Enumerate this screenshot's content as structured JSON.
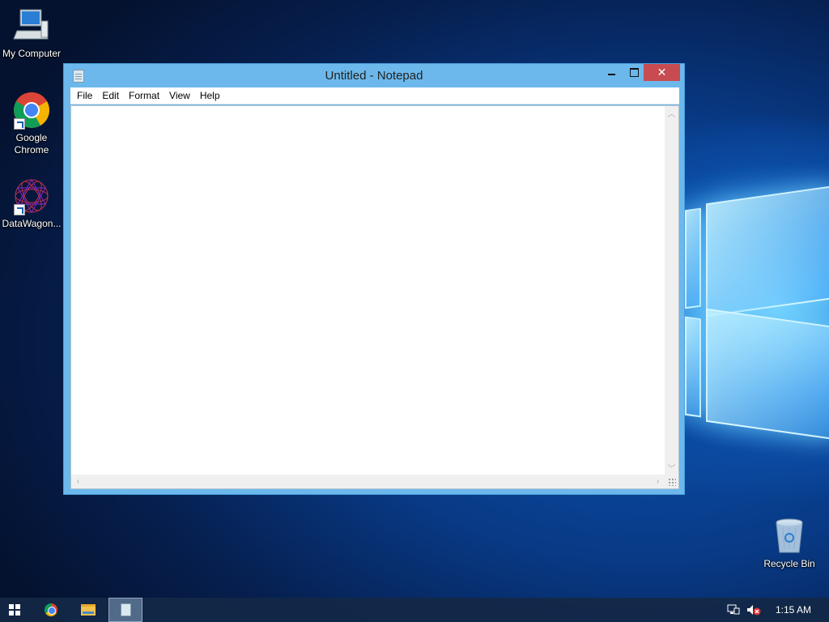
{
  "desktop": {
    "icons": [
      {
        "label": "My Computer",
        "icon": "computer-icon"
      },
      {
        "label": "Google Chrome",
        "icon": "chrome-icon"
      },
      {
        "label": "DataWagon...",
        "icon": "datawagon-icon"
      },
      {
        "label": "Recycle Bin",
        "icon": "recycle-bin-icon"
      }
    ]
  },
  "window": {
    "title": "Untitled - Notepad",
    "close_glyph": "✕",
    "menu": [
      "File",
      "Edit",
      "Format",
      "View",
      "Help"
    ],
    "content": "",
    "scroll_up_glyph": "︿",
    "scroll_down_glyph": "﹀",
    "scroll_left_glyph": "‹",
    "scroll_right_glyph": "›"
  },
  "taskbar": {
    "items": [
      {
        "name": "start",
        "icon": "windows-icon"
      },
      {
        "name": "chrome",
        "icon": "chrome-icon"
      },
      {
        "name": "file-explorer",
        "icon": "folder-icon"
      },
      {
        "name": "notepad",
        "icon": "notepad-icon",
        "active": true
      }
    ],
    "tray": {
      "network_icon": "network-icon",
      "volume_icon": "volume-muted-icon"
    },
    "clock": "1:15 AM"
  },
  "colors": {
    "titlebar": "#6cb8ec",
    "close": "#c74b50",
    "taskbar": "#14284a"
  }
}
